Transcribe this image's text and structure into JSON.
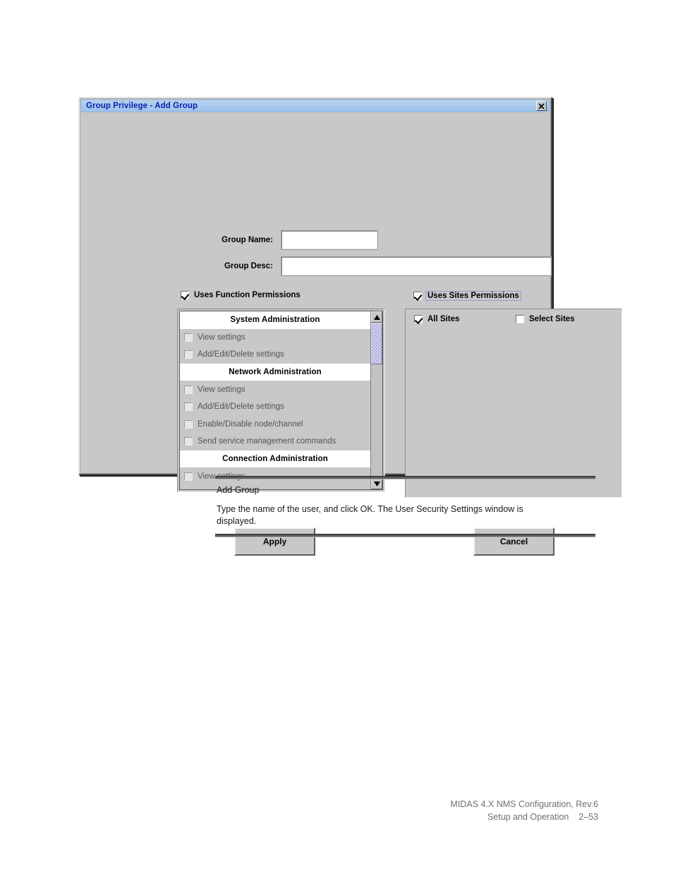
{
  "dialog": {
    "title": "Group Privilege - Add Group",
    "close_icon": "close-icon",
    "fields": {
      "group_name_label": "Group Name:",
      "group_name_value": "",
      "group_desc_label": "Group Desc:",
      "group_desc_value": ""
    },
    "function_permissions": {
      "checkbox_label": "Uses Function Permissions",
      "checked": true,
      "rows": [
        {
          "type": "header",
          "label": "System Administration"
        },
        {
          "type": "item",
          "label": "View settings",
          "checked": false
        },
        {
          "type": "item",
          "label": "Add/Edit/Delete settings",
          "checked": false
        },
        {
          "type": "header",
          "label": "Network Administration"
        },
        {
          "type": "item",
          "label": "View settings",
          "checked": false
        },
        {
          "type": "item",
          "label": "Add/Edit/Delete settings",
          "checked": false
        },
        {
          "type": "item",
          "label": "Enable/Disable node/channel",
          "checked": false
        },
        {
          "type": "item",
          "label": "Send service management commands",
          "checked": false
        },
        {
          "type": "header",
          "label": "Connection Administration"
        },
        {
          "type": "item",
          "label": "View settings",
          "checked": false
        }
      ],
      "scroll_up_icon": "triangle-up-icon",
      "scroll_down_icon": "triangle-down-icon"
    },
    "sites_permissions": {
      "checkbox_label": "Uses Sites Permissions",
      "checked": true,
      "options": [
        {
          "label": "All Sites",
          "checked": true
        },
        {
          "label": "Select Sites",
          "checked": false
        }
      ]
    },
    "buttons": {
      "apply": "Apply",
      "cancel": "Cancel"
    }
  },
  "caption": {
    "title": "Add Group",
    "body": "Type the name of the user, and click OK. The User Security Settings window is displayed."
  },
  "footer": {
    "line1": "MIDAS 4.X NMS Configuration, Rev.6",
    "line2": "Setup and Operation    2–53"
  },
  "colors": {
    "titlebar_text": "#0a1fb0",
    "dialog_face": "#c8c8c8",
    "scroll_thumb": "#a8a8d8",
    "rule": "#5c5c5c",
    "footer_text": "#6f6f6f"
  }
}
